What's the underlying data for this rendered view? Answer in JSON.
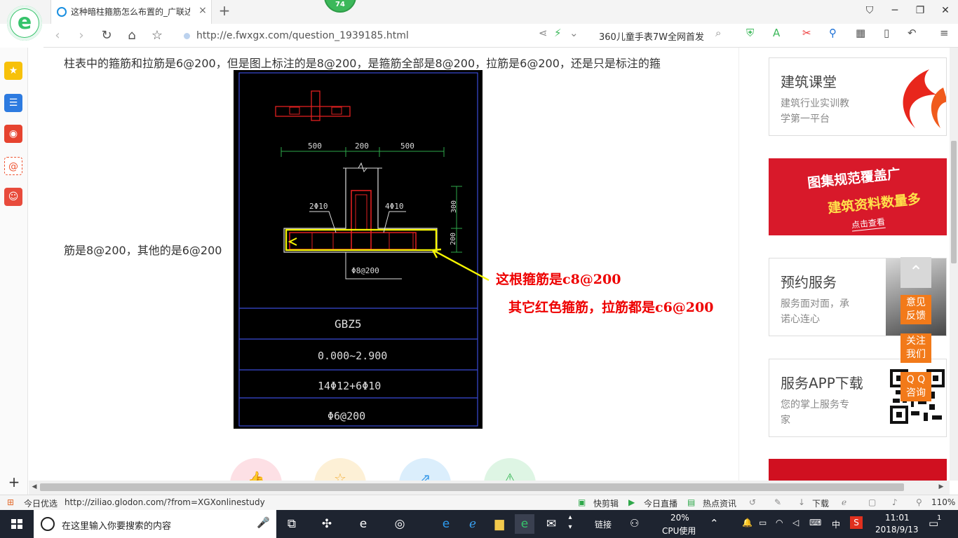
{
  "browser": {
    "tab_title": "这种暗柱箍筋怎么布置的_广联达",
    "tab_close": "×",
    "new_tab": "+",
    "badge": "74",
    "url": "http://e.fwxgx.com/question_1939185.html",
    "promo": "360儿童手表7W全网首发"
  },
  "question": {
    "line1": "柱表中的箍筋和拉筋是6@200，但是图上标注的是8@200，是箍筋全部是8@200，拉筋是6@200，还是只是标注的箍",
    "line2": "筋是8@200，其他的是6@200"
  },
  "drawing": {
    "dims": [
      "500",
      "200",
      "500"
    ],
    "vdims": [
      "300",
      "200"
    ],
    "left_bar": "2Φ10",
    "right_bar": "4Φ10",
    "stirrup_label": "Φ8@200",
    "table": [
      "GBZ5",
      "0.000~2.900",
      "14Φ12+6Φ10",
      "Φ6@200"
    ]
  },
  "annotations": {
    "note1": "这根箍筋是c8@200",
    "note2": "其它红色箍筋，拉筋都是c6@200"
  },
  "right_column": {
    "card1": {
      "title": "建筑课堂",
      "sub1": "建筑行业实训教",
      "sub2": "学第一平台"
    },
    "banner": {
      "line1": "图集规范覆盖广",
      "line2": "建筑资料数量多",
      "cta": "点击查看"
    },
    "card2": {
      "title": "预约服务",
      "sub1": "服务面对面，承",
      "sub2": "诺心连心"
    },
    "card3": {
      "title": "服务APP下载",
      "sub1": "您的掌上服务专",
      "sub2": "家"
    }
  },
  "floating": {
    "feedback": [
      "意见",
      "反馈"
    ],
    "follow": [
      "关注",
      "我们"
    ],
    "qq": [
      "Q Q",
      "咨询"
    ]
  },
  "statusbar": {
    "left_label": "今日优选",
    "link": "http://ziliao.glodon.com/?from=XGXonlinestudy",
    "items": [
      "快剪辑",
      "今日直播",
      "热点资讯",
      "下载"
    ],
    "zoom": "110%"
  },
  "taskbar": {
    "search_placeholder": "在这里输入你要搜索的内容",
    "link_label": "链接",
    "cpu_percent": "20%",
    "cpu_label": "CPU使用",
    "ime": "中",
    "time": "11:01",
    "date": "2018/9/13",
    "notif_count": "1"
  }
}
